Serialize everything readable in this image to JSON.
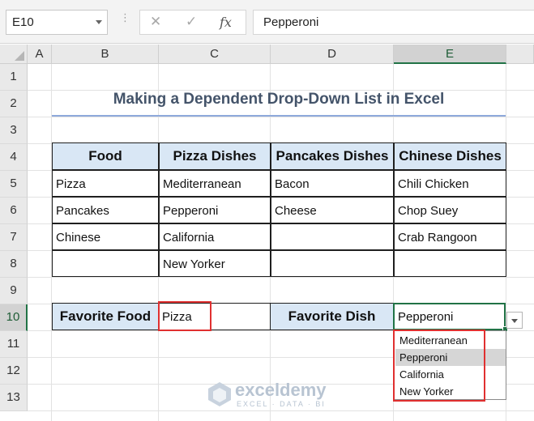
{
  "formula_bar": {
    "name_box": "E10",
    "cancel_symbol": "✕",
    "enter_symbol": "✓",
    "fx_label": "fx",
    "formula": "Pepperoni"
  },
  "columns": [
    "A",
    "B",
    "C",
    "D",
    "E"
  ],
  "rows": [
    "1",
    "2",
    "3",
    "4",
    "5",
    "6",
    "7",
    "8",
    "9",
    "10",
    "11",
    "12",
    "13"
  ],
  "selected_cell": {
    "column": "E",
    "row": "10"
  },
  "sheet": {
    "title": "Making a Dependent Drop-Down List in Excel",
    "table": {
      "headers": [
        "Food",
        "Pizza Dishes",
        "Pancakes Dishes",
        "Chinese Dishes"
      ],
      "rows": [
        [
          "Pizza",
          "Mediterranean",
          "Bacon",
          "Chili Chicken"
        ],
        [
          "Pancakes",
          "Pepperoni",
          "Cheese",
          "Chop Suey"
        ],
        [
          "Chinese",
          "California",
          "",
          "Crab Rangoon"
        ],
        [
          "",
          "New Yorker",
          "",
          ""
        ]
      ]
    },
    "favorite_food": {
      "label": "Favorite Food",
      "value": "Pizza"
    },
    "favorite_dish": {
      "label": "Favorite Dish",
      "value": "Pepperoni"
    },
    "dropdown": {
      "options": [
        "Mediterranean",
        "Pepperoni",
        "California",
        "New Yorker"
      ],
      "highlighted": "Pepperoni"
    }
  },
  "watermark": {
    "name": "exceldemy",
    "tagline": "EXCEL · DATA · BI"
  },
  "colors": {
    "accent": "#217346",
    "header_fill": "#d9e7f5",
    "highlight_box": "#e03030",
    "title": "#44546a"
  }
}
